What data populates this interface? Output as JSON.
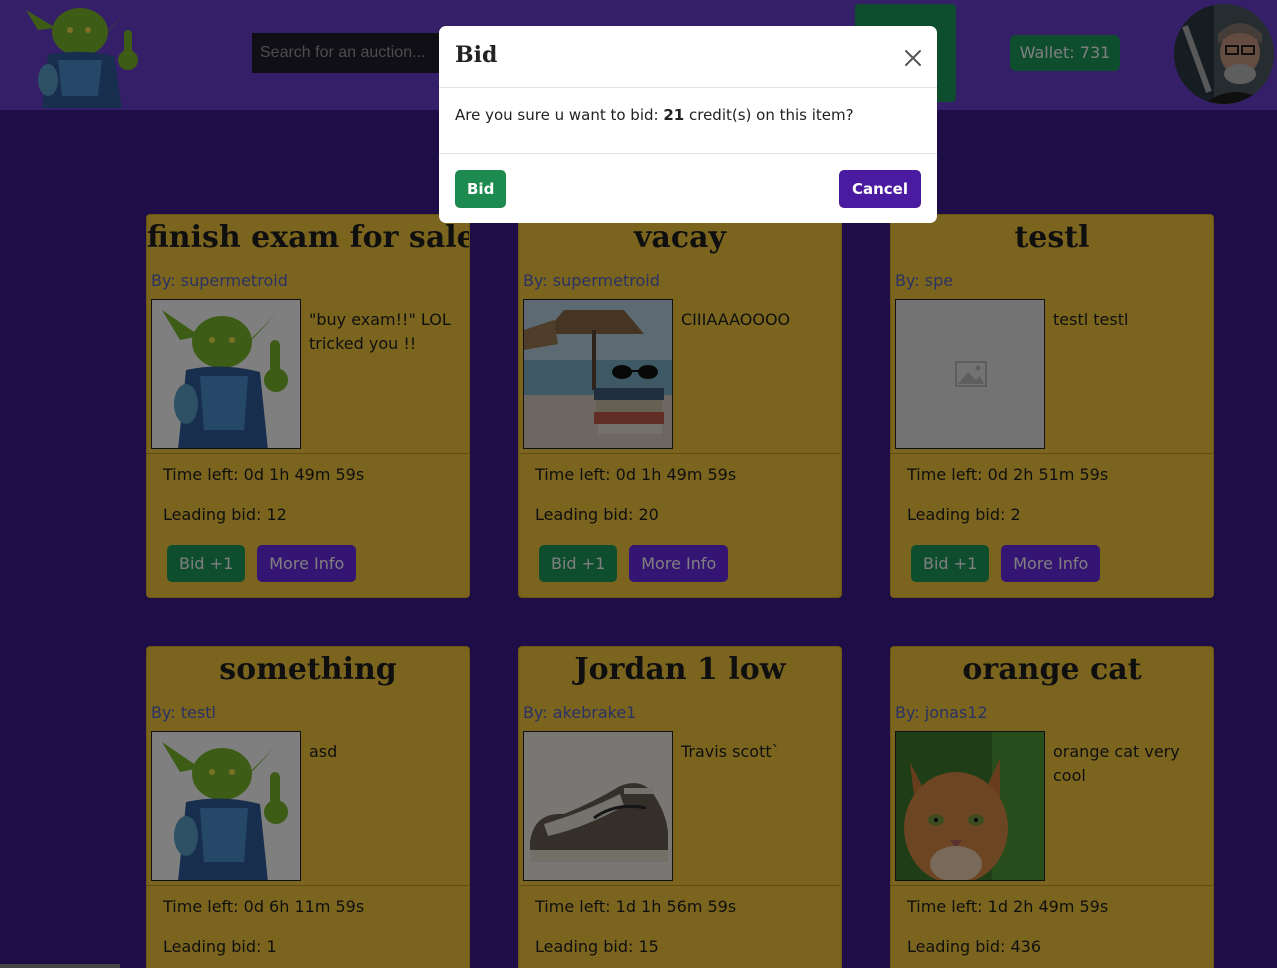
{
  "header": {
    "search_placeholder": "Search for an auction...",
    "wallet_label": "Wallet: 731"
  },
  "cards": [
    {
      "title": "finish exam for sale!!",
      "author": "By: supermetroid",
      "description": "\"buy exam!!\" LOL tricked you !!",
      "image": "goblin-image",
      "time_left": "Time left: 0d 1h 49m 59s",
      "leading_bid": "Leading bid: 12",
      "bid_label": "Bid +1",
      "info_label": "More Info"
    },
    {
      "title": "vacay",
      "author": "By: supermetroid",
      "description": "CIIIAAAOOOO",
      "image": "beach-books-image",
      "time_left": "Time left: 0d 1h 49m 59s",
      "leading_bid": "Leading bid: 20",
      "bid_label": "Bid +1",
      "info_label": "More Info"
    },
    {
      "title": "testl",
      "author": "By: spe",
      "description": "testl testl",
      "image": "placeholder-image",
      "time_left": "Time left: 0d 2h 51m 59s",
      "leading_bid": "Leading bid: 2",
      "bid_label": "Bid +1",
      "info_label": "More Info"
    },
    {
      "title": "something",
      "author": "By: testl",
      "description": "asd",
      "image": "goblin-image",
      "time_left": "Time left: 0d 6h 11m 59s",
      "leading_bid": "Leading bid: 1"
    },
    {
      "title": "Jordan 1 low",
      "author": "By: akebrake1",
      "description": "Travis scott`",
      "image": "sneaker-image",
      "time_left": "Time left: 1d 1h 56m 59s",
      "leading_bid": "Leading bid: 15"
    },
    {
      "title": "orange cat",
      "author": "By: jonas12",
      "description": "orange cat very cool",
      "image": "cat-image",
      "time_left": "Time left: 1d 2h 49m 59s",
      "leading_bid": "Leading bid: 436"
    }
  ],
  "modal": {
    "title": "Bid",
    "message_prefix": "Are you sure u want to bid: ",
    "amount": "21",
    "message_suffix": " credit(s) on this item?",
    "confirm_label": "Bid",
    "cancel_label": "Cancel"
  },
  "colors": {
    "background": "#3b1d8f",
    "navbar": "#6a3fd0",
    "card": "#f7cb3d",
    "bid_button": "#1d9a5b",
    "info_button": "#6a2ae6",
    "cancel_button": "#4a1aa0"
  }
}
